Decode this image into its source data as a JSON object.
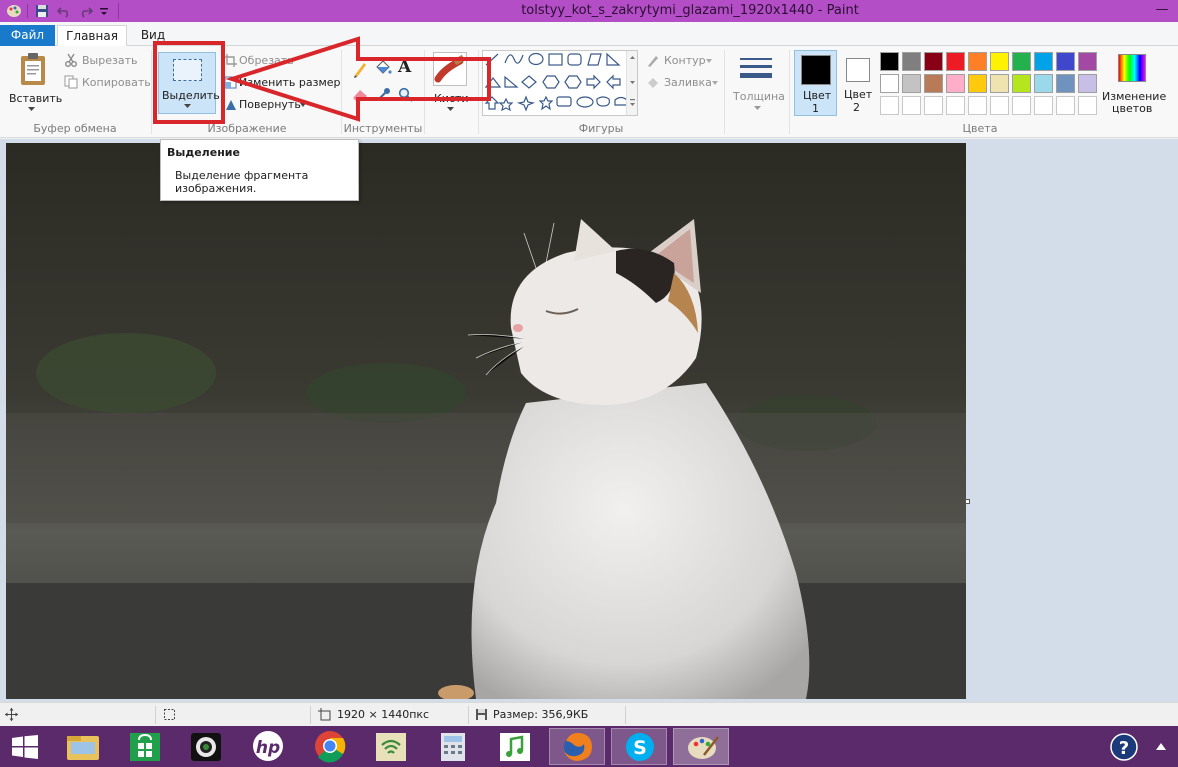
{
  "window": {
    "title": "tolstyy_kot_s_zakrytymi_glazami_1920x1440 - Paint"
  },
  "tabs": {
    "file": "Файл",
    "home": "Главная",
    "view": "Вид"
  },
  "ribbon": {
    "clipboard": {
      "group_label": "Буфер обмена",
      "paste": "Вставить",
      "cut": "Вырезать",
      "copy": "Копировать"
    },
    "image": {
      "group_label": "Изображение",
      "select": "Выделить",
      "crop": "Обрезать",
      "resize": "Изменить размер",
      "rotate": "Повернуть"
    },
    "tools": {
      "group_label": "Инструменты"
    },
    "brushes": {
      "label": "Кисти"
    },
    "shapes": {
      "group_label": "Фигуры",
      "outline": "Контур",
      "fill": "Заливка"
    },
    "size": {
      "label": "Толщина"
    },
    "colors": {
      "group_label": "Цвета",
      "color1_line1": "Цвет",
      "color1_line2": "1",
      "color2_line1": "Цвет",
      "color2_line2": "2",
      "edit_line1": "Изменение",
      "edit_line2": "цветов",
      "palette_row1": [
        "#000000",
        "#7f7f7f",
        "#880015",
        "#ed1c24",
        "#ff7f27",
        "#fff200",
        "#22b14c",
        "#00a2e8",
        "#3f48cc",
        "#a349a4"
      ],
      "palette_row2": [
        "#ffffff",
        "#c3c3c3",
        "#b97a57",
        "#ffaec9",
        "#ffc90e",
        "#efe4b0",
        "#b5e61d",
        "#99d9ea",
        "#7092be",
        "#c8bfe7"
      ]
    }
  },
  "tooltip": {
    "title": "Выделение",
    "description": "Выделение фрагмента\nизображения."
  },
  "statusbar": {
    "dimensions": "1920 × 1440пкс",
    "size": "Размер: 356,9КБ"
  },
  "colors": {
    "titlebar": "#b34ec7",
    "accent": "#1979ca",
    "annotation": "#d9262b",
    "taskbar": "#5a2a6b"
  }
}
